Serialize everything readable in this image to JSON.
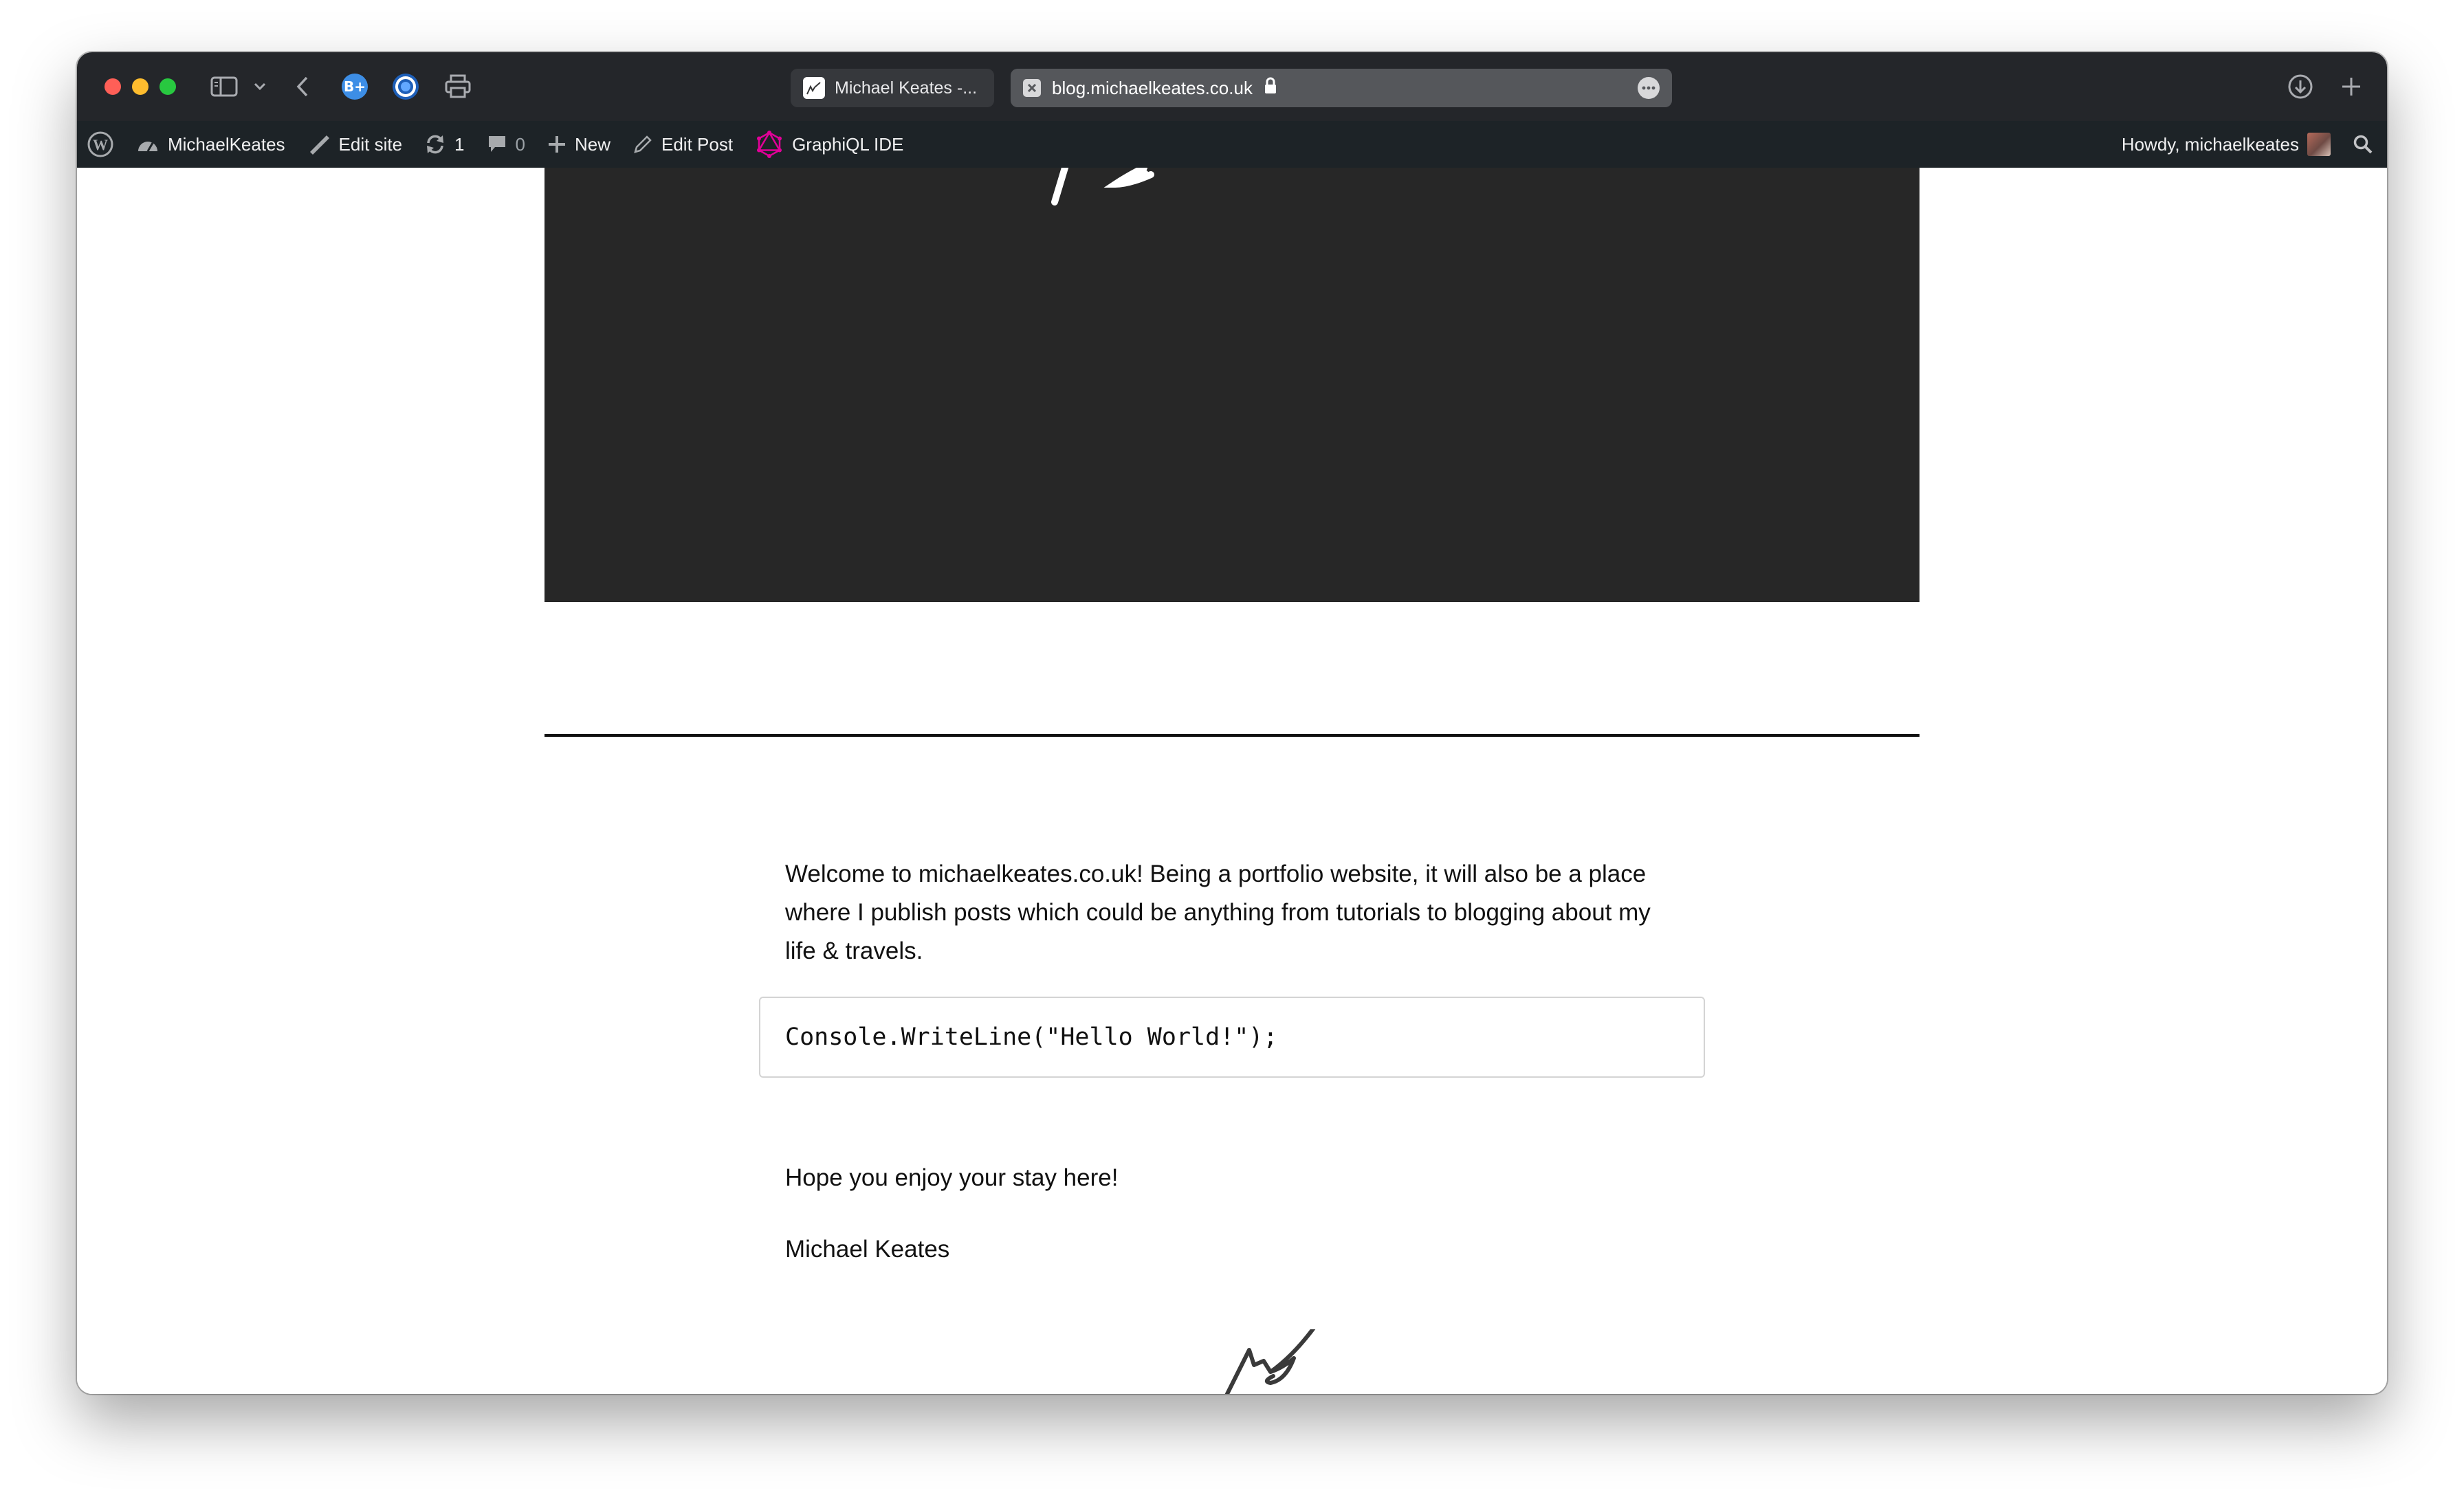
{
  "browser": {
    "tabs": [
      {
        "label": "Michael Keates -...",
        "active": false
      },
      {
        "label": "blog.michaelkeates.co.uk",
        "active": true
      }
    ],
    "toolbar_icons": [
      "sidebar-icon",
      "chevron-down-icon",
      "back-icon",
      "extension-icon",
      "shield-icon",
      "print-icon",
      "download-icon",
      "new-tab-icon"
    ]
  },
  "adminbar": {
    "site_name": "MichaelKeates",
    "edit_site": "Edit site",
    "updates_count": "1",
    "comments_count": "0",
    "new_label": "New",
    "edit_post": "Edit Post",
    "graphiql": "GraphiQL IDE",
    "howdy": "Howdy, michaelkeates"
  },
  "post": {
    "paragraph": "Welcome to michaelkeates.co.uk! Being a portfolio website, it will also be a place where I publish posts which could be anything from tutorials to blogging about my life & travels.",
    "code": "Console.WriteLine(\"Hello World!\");",
    "closing": "Hope you enjoy your stay here!",
    "author": "Michael Keates"
  },
  "colors": {
    "titlebar": "#24262a",
    "adminbar": "#1d2327",
    "hero": "#272727",
    "graphiql_accent": "#e10098"
  }
}
